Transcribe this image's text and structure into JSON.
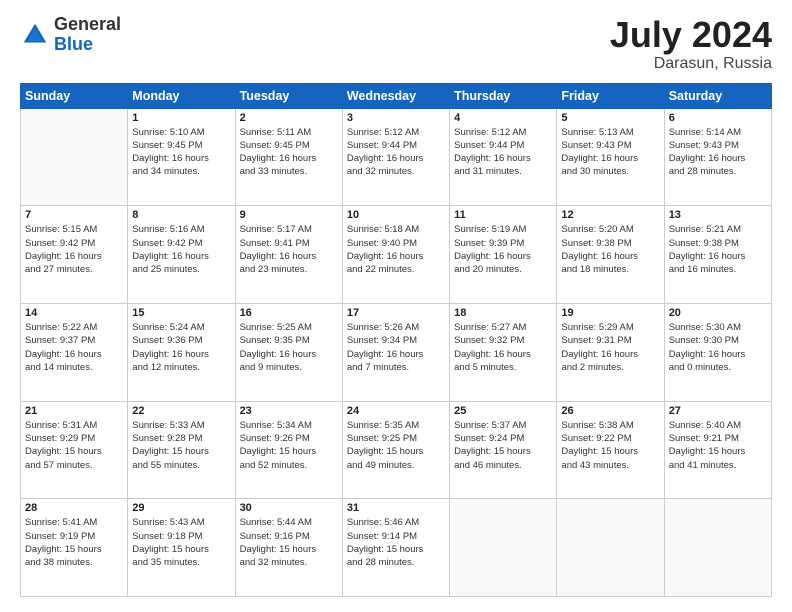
{
  "header": {
    "logo_general": "General",
    "logo_blue": "Blue",
    "month": "July 2024",
    "location": "Darasun, Russia"
  },
  "days_of_week": [
    "Sunday",
    "Monday",
    "Tuesday",
    "Wednesday",
    "Thursday",
    "Friday",
    "Saturday"
  ],
  "weeks": [
    [
      {
        "day": "",
        "info": ""
      },
      {
        "day": "1",
        "info": "Sunrise: 5:10 AM\nSunset: 9:45 PM\nDaylight: 16 hours\nand 34 minutes."
      },
      {
        "day": "2",
        "info": "Sunrise: 5:11 AM\nSunset: 9:45 PM\nDaylight: 16 hours\nand 33 minutes."
      },
      {
        "day": "3",
        "info": "Sunrise: 5:12 AM\nSunset: 9:44 PM\nDaylight: 16 hours\nand 32 minutes."
      },
      {
        "day": "4",
        "info": "Sunrise: 5:12 AM\nSunset: 9:44 PM\nDaylight: 16 hours\nand 31 minutes."
      },
      {
        "day": "5",
        "info": "Sunrise: 5:13 AM\nSunset: 9:43 PM\nDaylight: 16 hours\nand 30 minutes."
      },
      {
        "day": "6",
        "info": "Sunrise: 5:14 AM\nSunset: 9:43 PM\nDaylight: 16 hours\nand 28 minutes."
      }
    ],
    [
      {
        "day": "7",
        "info": "Sunrise: 5:15 AM\nSunset: 9:42 PM\nDaylight: 16 hours\nand 27 minutes."
      },
      {
        "day": "8",
        "info": "Sunrise: 5:16 AM\nSunset: 9:42 PM\nDaylight: 16 hours\nand 25 minutes."
      },
      {
        "day": "9",
        "info": "Sunrise: 5:17 AM\nSunset: 9:41 PM\nDaylight: 16 hours\nand 23 minutes."
      },
      {
        "day": "10",
        "info": "Sunrise: 5:18 AM\nSunset: 9:40 PM\nDaylight: 16 hours\nand 22 minutes."
      },
      {
        "day": "11",
        "info": "Sunrise: 5:19 AM\nSunset: 9:39 PM\nDaylight: 16 hours\nand 20 minutes."
      },
      {
        "day": "12",
        "info": "Sunrise: 5:20 AM\nSunset: 9:38 PM\nDaylight: 16 hours\nand 18 minutes."
      },
      {
        "day": "13",
        "info": "Sunrise: 5:21 AM\nSunset: 9:38 PM\nDaylight: 16 hours\nand 16 minutes."
      }
    ],
    [
      {
        "day": "14",
        "info": "Sunrise: 5:22 AM\nSunset: 9:37 PM\nDaylight: 16 hours\nand 14 minutes."
      },
      {
        "day": "15",
        "info": "Sunrise: 5:24 AM\nSunset: 9:36 PM\nDaylight: 16 hours\nand 12 minutes."
      },
      {
        "day": "16",
        "info": "Sunrise: 5:25 AM\nSunset: 9:35 PM\nDaylight: 16 hours\nand 9 minutes."
      },
      {
        "day": "17",
        "info": "Sunrise: 5:26 AM\nSunset: 9:34 PM\nDaylight: 16 hours\nand 7 minutes."
      },
      {
        "day": "18",
        "info": "Sunrise: 5:27 AM\nSunset: 9:32 PM\nDaylight: 16 hours\nand 5 minutes."
      },
      {
        "day": "19",
        "info": "Sunrise: 5:29 AM\nSunset: 9:31 PM\nDaylight: 16 hours\nand 2 minutes."
      },
      {
        "day": "20",
        "info": "Sunrise: 5:30 AM\nSunset: 9:30 PM\nDaylight: 16 hours\nand 0 minutes."
      }
    ],
    [
      {
        "day": "21",
        "info": "Sunrise: 5:31 AM\nSunset: 9:29 PM\nDaylight: 15 hours\nand 57 minutes."
      },
      {
        "day": "22",
        "info": "Sunrise: 5:33 AM\nSunset: 9:28 PM\nDaylight: 15 hours\nand 55 minutes."
      },
      {
        "day": "23",
        "info": "Sunrise: 5:34 AM\nSunset: 9:26 PM\nDaylight: 15 hours\nand 52 minutes."
      },
      {
        "day": "24",
        "info": "Sunrise: 5:35 AM\nSunset: 9:25 PM\nDaylight: 15 hours\nand 49 minutes."
      },
      {
        "day": "25",
        "info": "Sunrise: 5:37 AM\nSunset: 9:24 PM\nDaylight: 15 hours\nand 46 minutes."
      },
      {
        "day": "26",
        "info": "Sunrise: 5:38 AM\nSunset: 9:22 PM\nDaylight: 15 hours\nand 43 minutes."
      },
      {
        "day": "27",
        "info": "Sunrise: 5:40 AM\nSunset: 9:21 PM\nDaylight: 15 hours\nand 41 minutes."
      }
    ],
    [
      {
        "day": "28",
        "info": "Sunrise: 5:41 AM\nSunset: 9:19 PM\nDaylight: 15 hours\nand 38 minutes."
      },
      {
        "day": "29",
        "info": "Sunrise: 5:43 AM\nSunset: 9:18 PM\nDaylight: 15 hours\nand 35 minutes."
      },
      {
        "day": "30",
        "info": "Sunrise: 5:44 AM\nSunset: 9:16 PM\nDaylight: 15 hours\nand 32 minutes."
      },
      {
        "day": "31",
        "info": "Sunrise: 5:46 AM\nSunset: 9:14 PM\nDaylight: 15 hours\nand 28 minutes."
      },
      {
        "day": "",
        "info": ""
      },
      {
        "day": "",
        "info": ""
      },
      {
        "day": "",
        "info": ""
      }
    ]
  ]
}
